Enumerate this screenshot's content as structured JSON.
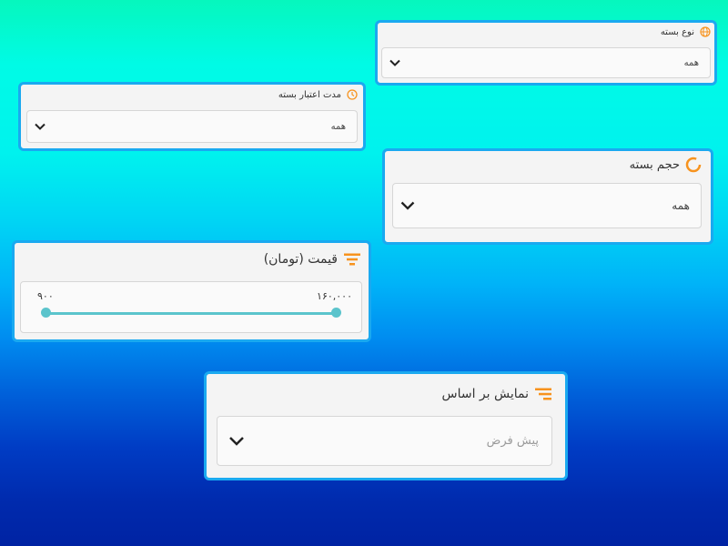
{
  "colors": {
    "accent_border": "#1aa9f0",
    "icon_orange": "#f7931e",
    "slider_teal": "#5bc4cc"
  },
  "package_type": {
    "label": "نوع بسته",
    "icon": "globe-icon",
    "value": "همه"
  },
  "package_validity": {
    "label": "مدت اعتبار بسته",
    "icon": "clock-icon",
    "value": "همه"
  },
  "package_volume": {
    "label": "حجم بسته",
    "icon": "circle-progress-icon",
    "value": "همه"
  },
  "price": {
    "label": "قیمت (تومان)",
    "icon": "filter-icon",
    "min_label": "۹۰۰",
    "max_label": "۱۶۰,۰۰۰"
  },
  "sort_by": {
    "label": "نمایش بر اساس",
    "icon": "sort-icon",
    "value": "پیش فرض"
  }
}
